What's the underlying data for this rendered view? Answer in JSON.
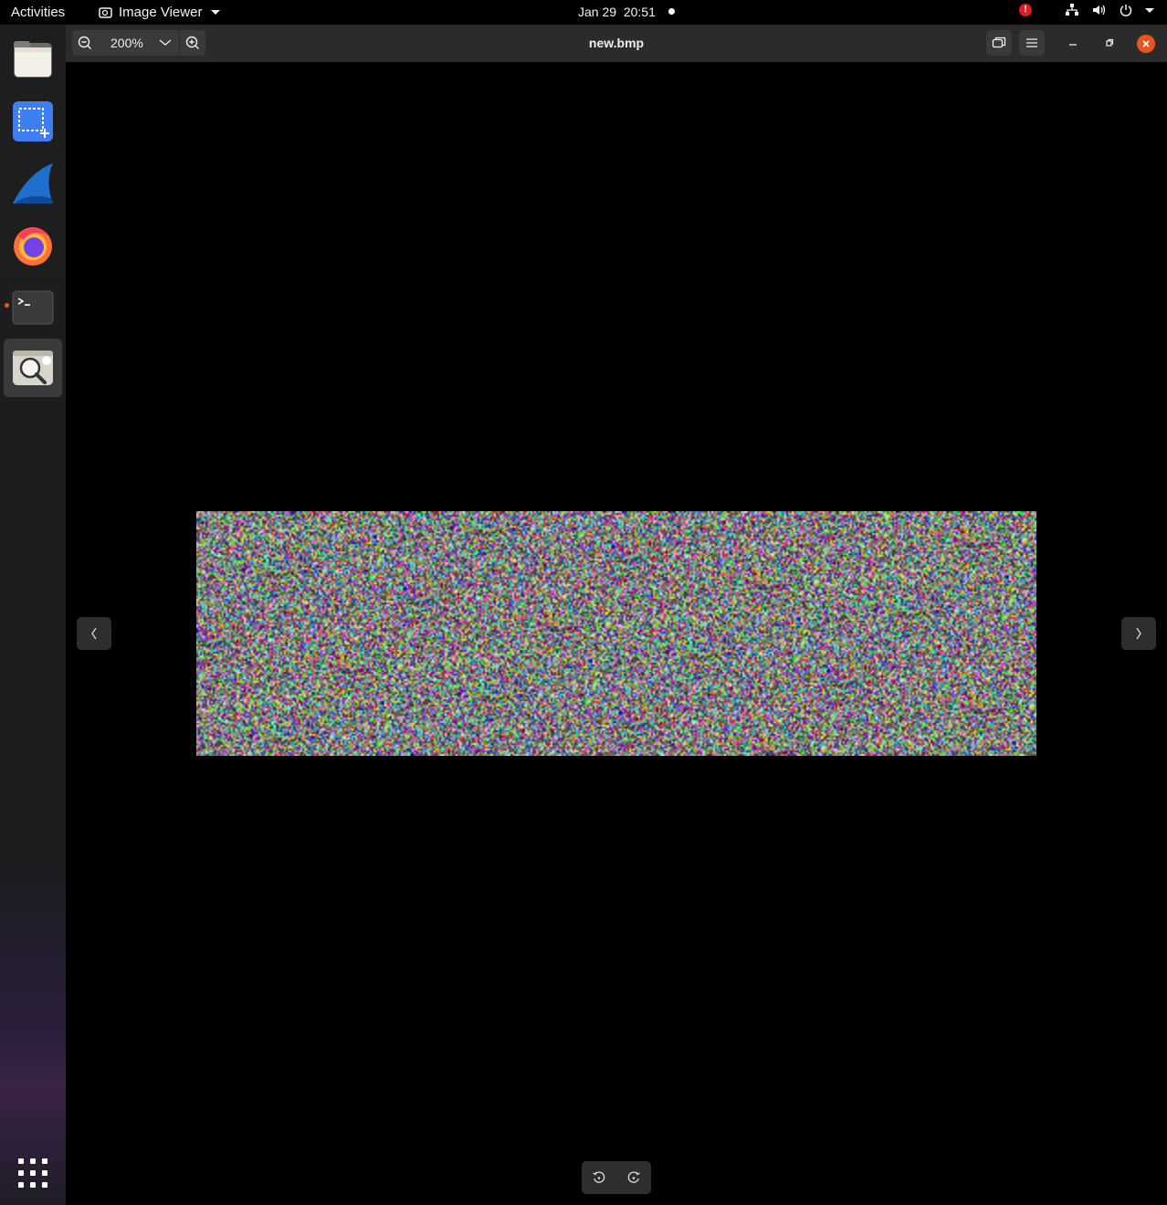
{
  "topbar": {
    "activities": "Activities",
    "app_name": "Image Viewer",
    "date": "Jan 29",
    "time": "20:51",
    "alert_badge": "!"
  },
  "dock": {
    "items": [
      "files-icon",
      "screenshot-icon",
      "wireshark-icon",
      "firefox-icon",
      "terminal-icon",
      "image-viewer-icon"
    ],
    "running": [
      "terminal-icon",
      "image-viewer-icon"
    ],
    "active": "image-viewer-icon"
  },
  "viewer": {
    "zoom_level": "200%",
    "filename": "new.bmp"
  },
  "colors": {
    "accent": "#e95420",
    "header_bg": "#2b2b2b",
    "button_bg": "#3a3a3a",
    "canvas_bg": "#000000"
  }
}
